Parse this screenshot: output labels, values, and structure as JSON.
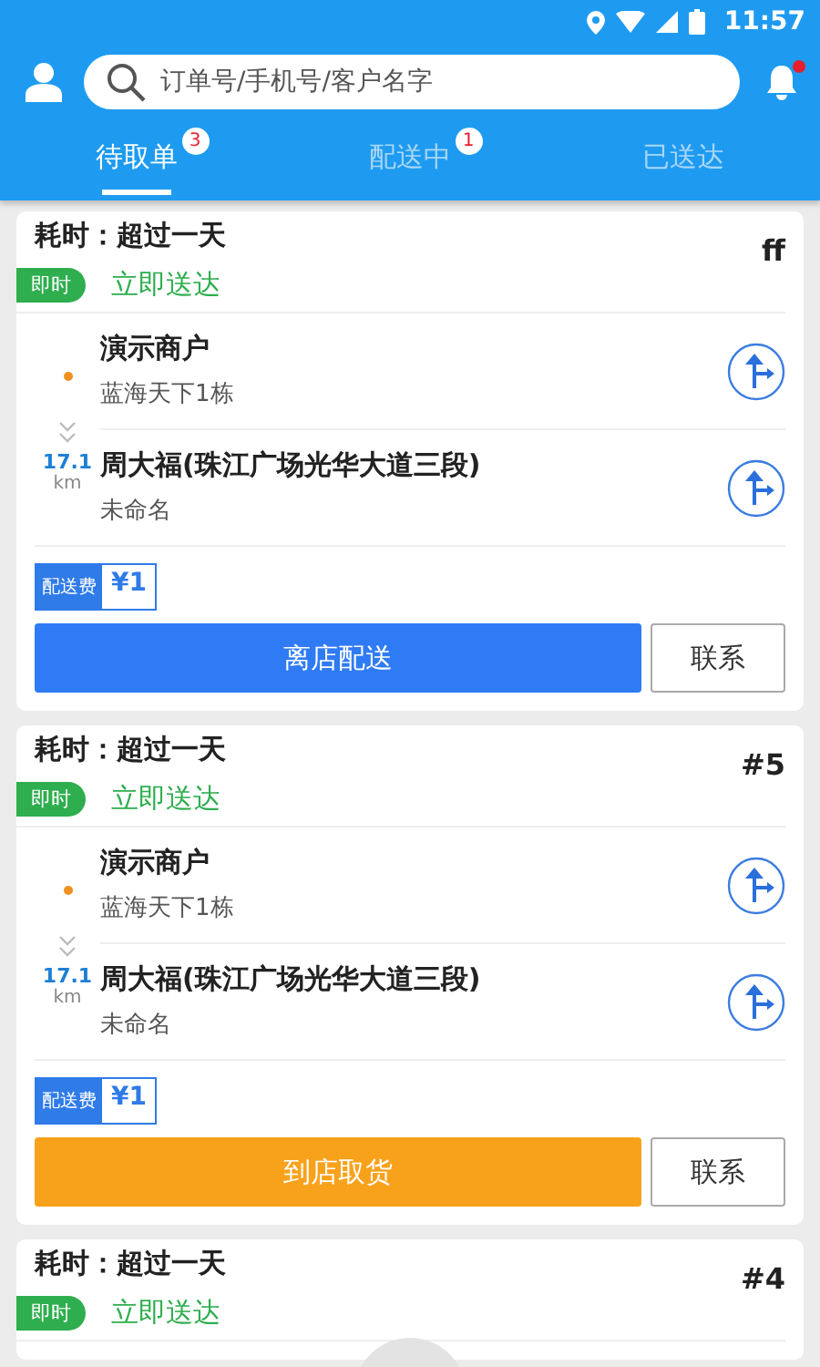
{
  "status_bar": {
    "time": "11:57"
  },
  "search": {
    "placeholder": "订单号/手机号/客户名字"
  },
  "notifications": {
    "unread": true
  },
  "tabs": [
    {
      "label": "待取单",
      "badge": "3",
      "selected": true
    },
    {
      "label": "配送中",
      "badge": "1",
      "selected": false
    },
    {
      "label": "已送达",
      "selected": false
    }
  ],
  "orders": [
    {
      "elapsed": "耗时：超过一天",
      "number": "ff",
      "tag": "即时",
      "delivery": "立即送达",
      "pickup": {
        "name": "演示商户",
        "address": "蓝海天下1栋"
      },
      "dropoff": {
        "name": "周大福(珠江广场光华大道三段)",
        "address": "未命名"
      },
      "distance": "17.1",
      "unit": "km",
      "fee_label": "配送费",
      "fee": "¥1",
      "action": {
        "label": "离店配送",
        "kind": "deliver"
      },
      "contact": "联系"
    },
    {
      "elapsed": "耗时：超过一天",
      "number": "#5",
      "tag": "即时",
      "delivery": "立即送达",
      "pickup": {
        "name": "演示商户",
        "address": "蓝海天下1栋"
      },
      "dropoff": {
        "name": "周大福(珠江广场光华大道三段)",
        "address": "未命名"
      },
      "distance": "17.1",
      "unit": "km",
      "fee_label": "配送费",
      "fee": "¥1",
      "action": {
        "label": "到店取货",
        "kind": "pickup"
      },
      "contact": "联系"
    },
    {
      "elapsed": "耗时：超过一天",
      "number": "#4",
      "tag": "即时",
      "delivery": "立即送达"
    }
  ]
}
